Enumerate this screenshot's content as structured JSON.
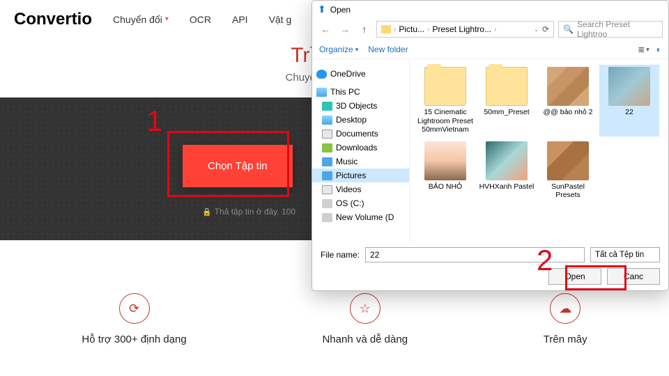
{
  "nav": {
    "logo": "Convertio",
    "items": [
      "Chuyển đổi",
      "OCR",
      "API",
      "Vật g"
    ]
  },
  "hero": {
    "title": "Trình chu",
    "subtitle": "Chuyển đổi tập tin củ",
    "choose": "Chọn Tập tin",
    "drop_hint": "Thả tập tin ở đây. 100"
  },
  "callouts": {
    "one": "1",
    "two": "2"
  },
  "features": {
    "a": "Hỗ trợ 300+ định dạng",
    "b": "Nhanh và dễ dàng",
    "c": "Trên mây"
  },
  "dialog": {
    "title": "Open",
    "crumbs": [
      "Pictu...",
      "Preset Lightro..."
    ],
    "search_placeholder": "Search Preset Lightroo",
    "organize": "Organize",
    "new_folder": "New folder",
    "tree": {
      "onedrive": "OneDrive",
      "this_pc": "This PC",
      "obj3d": "3D Objects",
      "desktop": "Desktop",
      "documents": "Documents",
      "downloads": "Downloads",
      "music": "Music",
      "pictures": "Pictures",
      "videos": "Videos",
      "osc": "OS (C:)",
      "newvol": "New Volume (D"
    },
    "files": {
      "f1": "15 Cinematic Lightroom Preset 50mmVietnam",
      "f2": "50mm_Preset",
      "f3": "@@ bảo nhỏ 2",
      "f4": "22",
      "f5": "BẢO NHỎ",
      "f6": "HVHXanh Pastel",
      "f7": "SunPastel Presets"
    },
    "file_label": "File name:",
    "file_value": "22",
    "filter": "Tất cả Tệp tin",
    "open": "Open",
    "cancel": "Canc"
  }
}
